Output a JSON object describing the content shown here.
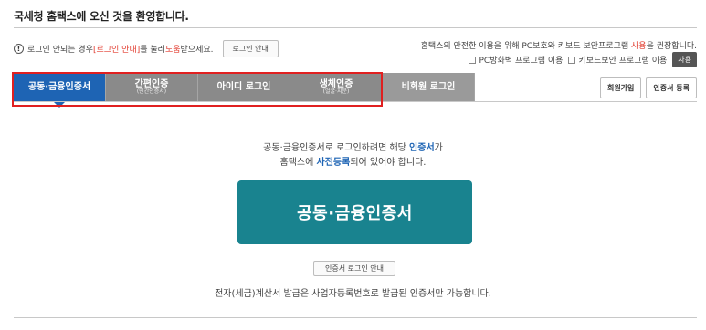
{
  "header": {
    "welcome": "국세청 홈택스에 오신 것을 환영합니다."
  },
  "notice": {
    "part1": "로그인 안되는 경우 ",
    "red1": "[로그인 안내]",
    "part2": "를 눌러 ",
    "red2": "도움",
    "part3": "받으세요.",
    "button": "로그인 안내"
  },
  "security": {
    "part1": "홈택스의 안전한 이용을 위해 PC보호와 키보드 보안프로그램 ",
    "red": "사용",
    "part2": "을 권장합니다.",
    "option1": "PC방화벽 프로그램 이용",
    "option2": "키보드보안 프로그램 이용",
    "use_button": "사용"
  },
  "tabs": [
    {
      "label": "공동·금융인증서",
      "sub": ""
    },
    {
      "label": "간편인증",
      "sub": "(민간인증서)"
    },
    {
      "label": "아이디 로그인",
      "sub": ""
    },
    {
      "label": "생체인증",
      "sub": "(얼굴·지문)"
    },
    {
      "label": "비회원 로그인",
      "sub": ""
    }
  ],
  "right_buttons": {
    "signup": "회원가입",
    "cert_register": "인증서 등록"
  },
  "main": {
    "line1_a": "공동·금융인증서로 로그인하려면 해당 ",
    "line1_blue": "인증서",
    "line1_b": "가",
    "line2_a": "홈택스에 ",
    "line2_blue": "사전등록",
    "line2_b": "되어 있어야 합니다.",
    "cert_button": "공동·금융인증서",
    "guide_button": "인증서 로그인 안내",
    "footnote": "전자(세금)계산서 발급은 사업자등록번호로 발급된 인증서만 가능합니다."
  },
  "colors": {
    "active_tab": "#1e64b4",
    "inactive_tab": "#8a8a8a",
    "cert_button": "#19838f",
    "highlight": "#e02020"
  }
}
